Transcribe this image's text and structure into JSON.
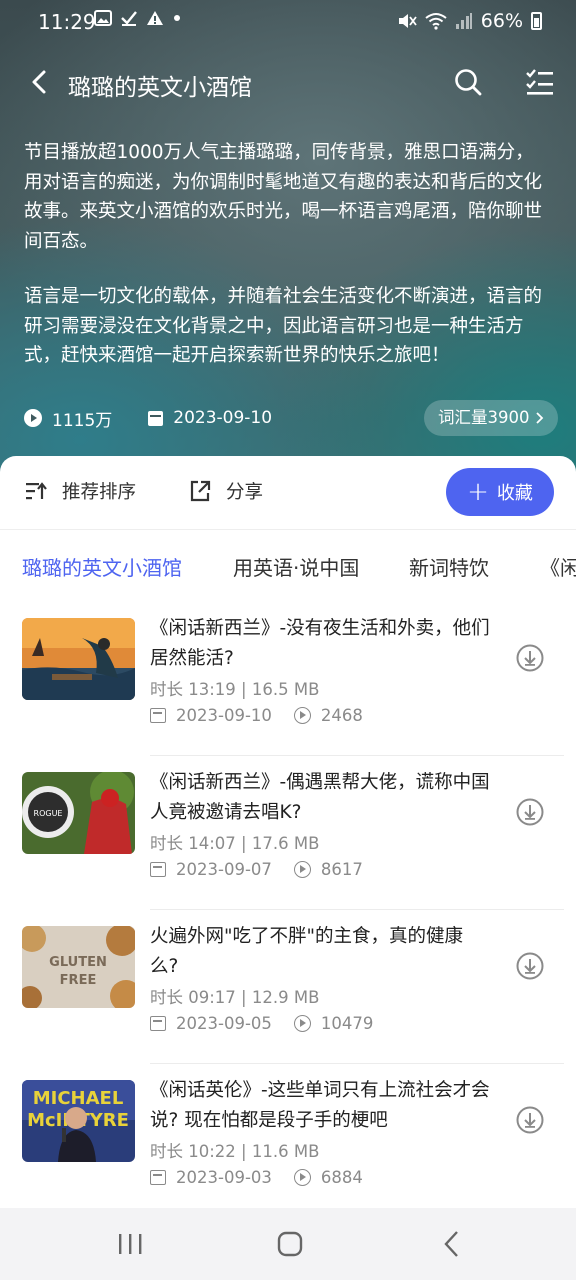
{
  "status_bar": {
    "time": "11:29",
    "battery": "66%"
  },
  "nav": {
    "title": "璐璐的英文小酒馆"
  },
  "description": {
    "para1": "节目播放超1000万人气主播璐璐，同传背景，雅思口语满分，用对语言的痴迷，为你调制时髦地道又有趣的表达和背后的文化故事。来英文小酒馆的欢乐时光，喝一杯语言鸡尾酒，陪你聊世间百态。",
    "para2": "语言是一切文化的载体，并随着社会生活变化不断演进，语言的研习需要浸没在文化背景之中，因此语言研习也是一种生活方式，赶快来酒馆一起开启探索新世界的快乐之旅吧！"
  },
  "stats": {
    "plays": "1115万",
    "date": "2023-09-10",
    "vocab": "词汇量3900"
  },
  "toolbar": {
    "sort_label": "推荐排序",
    "share_label": "分享",
    "collect_label": "收藏"
  },
  "tabs": [
    "璐璐的英文小酒馆",
    "用英语·说中国",
    "新词特饮",
    "《闲"
  ],
  "episodes": [
    {
      "title": "《闲话新西兰》-没有夜生活和外卖，他们居然能活?",
      "meta": "时长 13:19 |  16.5 MB",
      "date": "2023-09-10",
      "plays": "2468"
    },
    {
      "title": "《闲话新西兰》-偶遇黑帮大佬，谎称中国人竟被邀请去唱K?",
      "meta": "时长 14:07 |  17.6 MB",
      "date": "2023-09-07",
      "plays": "8617"
    },
    {
      "title": "火遍外网\"吃了不胖\"的主食，真的健康么?",
      "meta": "时长 09:17 |  12.9 MB",
      "date": "2023-09-05",
      "plays": "10479"
    },
    {
      "title": "《闲话英伦》-这些单词只有上流社会才会说? 现在怕都是段子手的梗吧",
      "meta": "时长 10:22 |  11.6 MB",
      "date": "2023-09-03",
      "plays": "6884"
    }
  ],
  "thumb_text": {
    "gluten": "GLUTEN",
    "free": "FREE",
    "rogue": "ROGUE",
    "michael": "MICHAEL",
    "mcintyre": "McINTYRE"
  },
  "colors": {
    "accent": "#4e64f0",
    "muted_text": "#8a8a8a"
  }
}
